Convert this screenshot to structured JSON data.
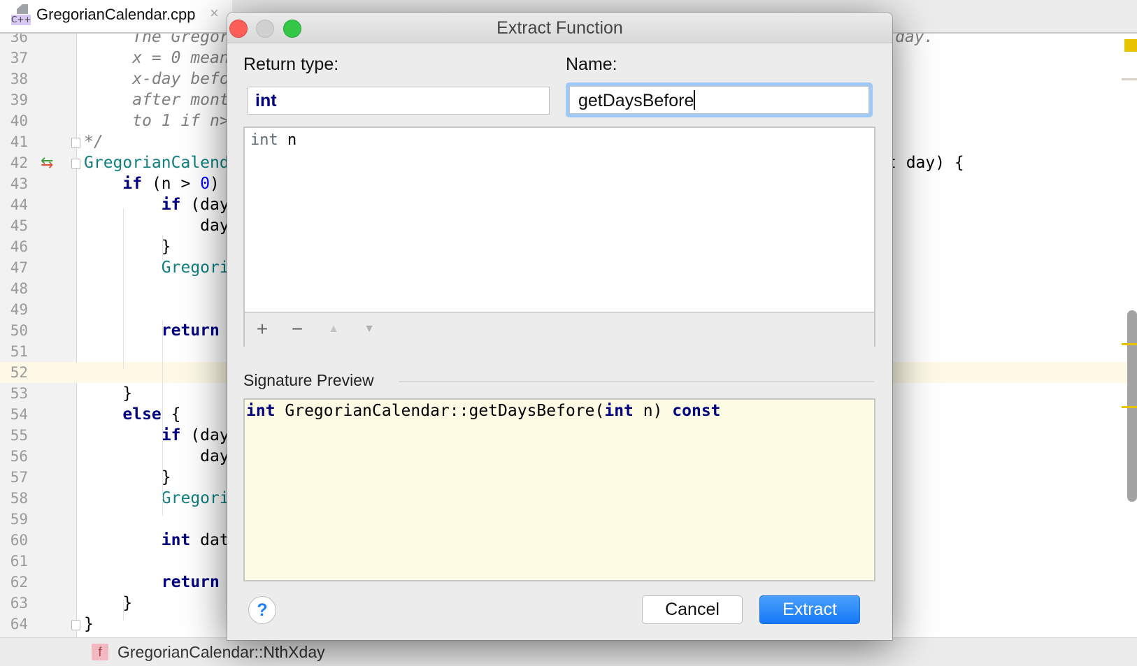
{
  "tab": {
    "icon": "cpp-file-icon",
    "icon_label": "C++",
    "title": "GregorianCalendar.cpp",
    "close": "×"
  },
  "editor": {
    "current_line": 52,
    "lines": [
      {
        "n": "36",
        "seg": [
          [
            "     The Gregor",
            "cmt"
          ]
        ]
      },
      {
        "n": "37",
        "seg": [
          [
            "     x = 0 mean",
            "cmt"
          ]
        ]
      },
      {
        "n": "38",
        "seg": [
          [
            "     x-day befo",
            "cmt"
          ]
        ]
      },
      {
        "n": "39",
        "seg": [
          [
            "     after mont",
            "cmt"
          ]
        ]
      },
      {
        "n": "40",
        "seg": [
          [
            "     to 1 if n>",
            "cmt"
          ]
        ]
      },
      {
        "n": "41",
        "seg": [
          [
            "*/",
            "cmt"
          ]
        ],
        "fold": true
      },
      {
        "n": "42",
        "seg": [
          [
            "GregorianCalend",
            "cls"
          ]
        ],
        "fold": true,
        "arrows": true
      },
      {
        "n": "43",
        "seg": [
          [
            "    ",
            ""
          ],
          [
            "if",
            "kw"
          ],
          [
            " (n > ",
            ""
          ],
          [
            "0",
            "num"
          ],
          [
            ")",
            ""
          ]
        ]
      },
      {
        "n": "44",
        "seg": [
          [
            "        ",
            ""
          ],
          [
            "if",
            "kw"
          ],
          [
            " (day",
            ""
          ]
        ]
      },
      {
        "n": "45",
        "seg": [
          [
            "            day",
            ""
          ]
        ]
      },
      {
        "n": "46",
        "seg": [
          [
            "        }",
            ""
          ]
        ]
      },
      {
        "n": "47",
        "seg": [
          [
            "        ",
            ""
          ],
          [
            "Gregori",
            "cls"
          ]
        ]
      },
      {
        "n": "48",
        "seg": []
      },
      {
        "n": "49",
        "seg": []
      },
      {
        "n": "50",
        "seg": [
          [
            "        ",
            ""
          ],
          [
            "return",
            "kw"
          ]
        ]
      },
      {
        "n": "51",
        "seg": []
      },
      {
        "n": "52",
        "seg": []
      },
      {
        "n": "53",
        "seg": [
          [
            "    }",
            ""
          ]
        ]
      },
      {
        "n": "54",
        "seg": [
          [
            "    ",
            ""
          ],
          [
            "else",
            "kw"
          ],
          [
            " {",
            ""
          ]
        ]
      },
      {
        "n": "55",
        "seg": [
          [
            "        ",
            ""
          ],
          [
            "if",
            "kw"
          ],
          [
            " (day",
            ""
          ]
        ]
      },
      {
        "n": "56",
        "seg": [
          [
            "            day",
            ""
          ]
        ]
      },
      {
        "n": "57",
        "seg": [
          [
            "        }",
            ""
          ]
        ]
      },
      {
        "n": "58",
        "seg": [
          [
            "        ",
            ""
          ],
          [
            "Gregori",
            "cls"
          ]
        ]
      },
      {
        "n": "59",
        "seg": []
      },
      {
        "n": "60",
        "seg": [
          [
            "        ",
            ""
          ],
          [
            "int",
            "kw"
          ],
          [
            " dat",
            ""
          ]
        ]
      },
      {
        "n": "61",
        "seg": []
      },
      {
        "n": "62",
        "seg": [
          [
            "        ",
            ""
          ],
          [
            "return",
            "kw"
          ]
        ]
      },
      {
        "n": "63",
        "seg": [
          [
            "    }",
            ""
          ]
        ]
      },
      {
        "n": "64",
        "seg": [
          [
            "}",
            ""
          ]
        ],
        "fold": true
      }
    ],
    "right_fragments": {
      "line36": "day.",
      "line42": "t day) {"
    }
  },
  "status": {
    "icon": "function-icon",
    "icon_label": "f",
    "breadcrumb": "GregorianCalendar::NthXday"
  },
  "dialog": {
    "title": "Extract Function",
    "return_type_label": "Return type:",
    "return_type_value": "int",
    "name_label": "Name:",
    "name_value": "getDaysBefore",
    "parameters": [
      {
        "type": "int",
        "name": "n"
      }
    ],
    "toolbar": {
      "add": "+",
      "remove": "−",
      "up": "▲",
      "down": "▼"
    },
    "signature_label": "Signature Preview",
    "signature": {
      "ret": "int",
      "qualified": " GregorianCalendar::getDaysBefore(",
      "ptype": "int",
      "rest": " n) ",
      "const": "const"
    },
    "help": "?",
    "cancel": "Cancel",
    "extract": "Extract"
  },
  "colors": {
    "accent": "#1479f7",
    "keyword": "#000080",
    "class": "#0f7f7f",
    "comment": "#808080",
    "current_line": "#fdf9e6",
    "preview_bg": "#fdfbe3",
    "marker": "#e8c400"
  }
}
